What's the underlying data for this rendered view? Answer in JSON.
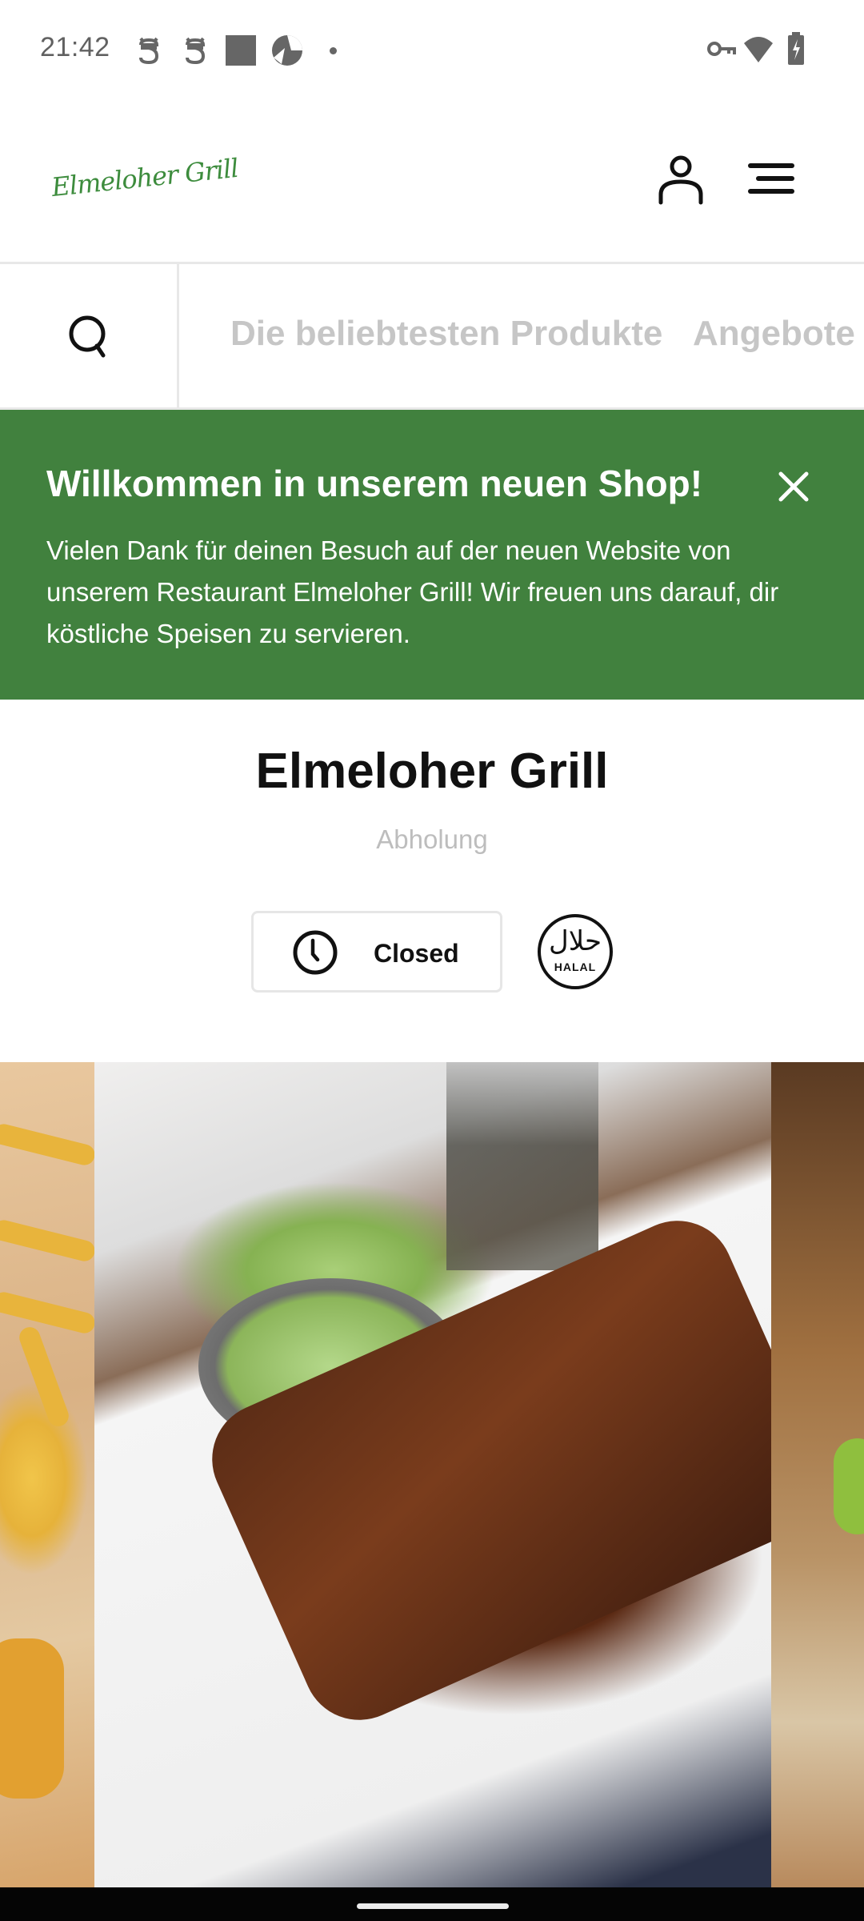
{
  "status_bar": {
    "time": "21:42",
    "left_icons": [
      "notification-s-icon",
      "notification-s-icon",
      "square-app-icon",
      "aperture-app-icon",
      "more-notifications-dot"
    ],
    "right_icons": [
      "vpn-key-icon",
      "wifi-icon",
      "battery-charging-icon"
    ]
  },
  "header": {
    "logo_text": "Elmeloher Grill",
    "icons": [
      "user-icon",
      "menu-icon"
    ]
  },
  "category_nav": {
    "search_icon": "search-icon",
    "items": [
      {
        "label": "Die beliebtesten Produkte"
      },
      {
        "label": "Angebote"
      }
    ]
  },
  "welcome_banner": {
    "title": "Willkommen in unserem neuen Shop!",
    "text": "Vielen Dank für deinen Besuch auf der neuen Website von unserem Restaurant Elmeloher Grill! Wir freuen uns darauf, dir köstliche Speisen zu servieren.",
    "close_icon": "close-icon",
    "background_color": "#41813e"
  },
  "shop": {
    "name": "Elmeloher Grill",
    "mode": "Abholung",
    "hours_status": "Closed",
    "badge": {
      "arabic": "حلال",
      "label": "HALAL"
    }
  },
  "carousel": {
    "slides": [
      {
        "description": "fish and chips with lemon"
      },
      {
        "description": "barbecue ribs with fries and coleslaw"
      },
      {
        "description": "burger with lettuce"
      }
    ]
  }
}
